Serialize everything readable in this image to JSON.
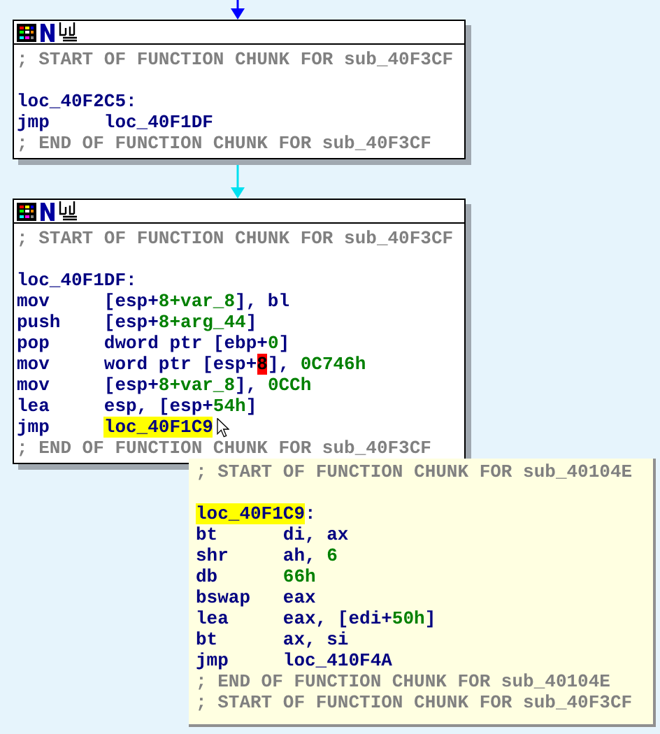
{
  "nodes": [
    {
      "lines": [
        {
          "kind": "comment",
          "text": "; START OF FUNCTION CHUNK FOR sub_40F3CF"
        },
        {
          "kind": "blank"
        },
        {
          "kind": "label",
          "parts": [
            {
              "text": "loc_40F2C5:",
              "kind": "op"
            }
          ]
        },
        {
          "kind": "instr",
          "mnemonic": "jmp",
          "operands": [
            {
              "text": "loc_40F1DF",
              "kind": "op"
            }
          ]
        },
        {
          "kind": "comment",
          "text": "; END OF FUNCTION CHUNK FOR sub_40F3CF"
        }
      ]
    },
    {
      "lines": [
        {
          "kind": "comment",
          "text": "; START OF FUNCTION CHUNK FOR sub_40F3CF"
        },
        {
          "kind": "blank"
        },
        {
          "kind": "label",
          "parts": [
            {
              "text": "loc_40F1DF:",
              "kind": "op"
            }
          ]
        },
        {
          "kind": "instr",
          "mnemonic": "mov",
          "operands": [
            {
              "text": "[esp+",
              "kind": "op"
            },
            {
              "text": "8+var_8",
              "kind": "num"
            },
            {
              "text": "], bl",
              "kind": "op"
            }
          ]
        },
        {
          "kind": "instr",
          "mnemonic": "push",
          "operands": [
            {
              "text": "[esp+",
              "kind": "op"
            },
            {
              "text": "8+arg_44",
              "kind": "num"
            },
            {
              "text": "]",
              "kind": "op"
            }
          ]
        },
        {
          "kind": "instr",
          "mnemonic": "pop",
          "operands": [
            {
              "text": "dword ptr [ebp+",
              "kind": "op"
            },
            {
              "text": "0",
              "kind": "num"
            },
            {
              "text": "]",
              "kind": "op"
            }
          ]
        },
        {
          "kind": "instr",
          "mnemonic": "mov",
          "operands": [
            {
              "text": "word ptr [esp+",
              "kind": "op"
            },
            {
              "text": "8",
              "kind": "err"
            },
            {
              "text": "], ",
              "kind": "op"
            },
            {
              "text": "0C746h",
              "kind": "num"
            }
          ]
        },
        {
          "kind": "instr",
          "mnemonic": "mov",
          "operands": [
            {
              "text": "[esp+",
              "kind": "op"
            },
            {
              "text": "8+var_8",
              "kind": "num"
            },
            {
              "text": "], ",
              "kind": "op"
            },
            {
              "text": "0CCh",
              "kind": "num"
            }
          ]
        },
        {
          "kind": "instr",
          "mnemonic": "lea",
          "operands": [
            {
              "text": "esp, [esp+",
              "kind": "op"
            },
            {
              "text": "54h",
              "kind": "num"
            },
            {
              "text": "]",
              "kind": "op"
            }
          ]
        },
        {
          "kind": "instr",
          "mnemonic": "jmp",
          "operands": [
            {
              "text": "loc_40F1C9",
              "kind": "hl"
            }
          ]
        },
        {
          "kind": "comment",
          "text": "; END OF FUNCTION CHUNK FOR sub_40F3CF"
        }
      ]
    }
  ],
  "tooltip": {
    "lines": [
      {
        "kind": "comment",
        "text": "; START OF FUNCTION CHUNK FOR sub_40104E"
      },
      {
        "kind": "blank"
      },
      {
        "kind": "label",
        "parts": [
          {
            "text": "loc_40F1C9",
            "kind": "hl"
          },
          {
            "text": ":",
            "kind": "op"
          }
        ]
      },
      {
        "kind": "instr",
        "mnemonic": "bt",
        "operands": [
          {
            "text": "di, ax",
            "kind": "op"
          }
        ]
      },
      {
        "kind": "instr",
        "mnemonic": "shr",
        "operands": [
          {
            "text": "ah, ",
            "kind": "op"
          },
          {
            "text": "6",
            "kind": "num"
          }
        ]
      },
      {
        "kind": "instr",
        "mnemonic": "db",
        "operands": [
          {
            "text": "66h",
            "kind": "num"
          }
        ]
      },
      {
        "kind": "instr",
        "mnemonic": "bswap",
        "operands": [
          {
            "text": "eax",
            "kind": "op"
          }
        ]
      },
      {
        "kind": "instr",
        "mnemonic": "lea",
        "operands": [
          {
            "text": "eax, [edi+",
            "kind": "op"
          },
          {
            "text": "50h",
            "kind": "num"
          },
          {
            "text": "]",
            "kind": "op"
          }
        ]
      },
      {
        "kind": "instr",
        "mnemonic": "bt",
        "operands": [
          {
            "text": "ax, si",
            "kind": "op"
          }
        ]
      },
      {
        "kind": "instr",
        "mnemonic": "jmp",
        "operands": [
          {
            "text": "loc_410F4A",
            "kind": "op"
          }
        ]
      },
      {
        "kind": "comment",
        "text": "; END OF FUNCTION CHUNK FOR sub_40104E"
      },
      {
        "kind": "comment",
        "text": "; START OF FUNCTION CHUNK FOR sub_40F3CF"
      }
    ]
  }
}
